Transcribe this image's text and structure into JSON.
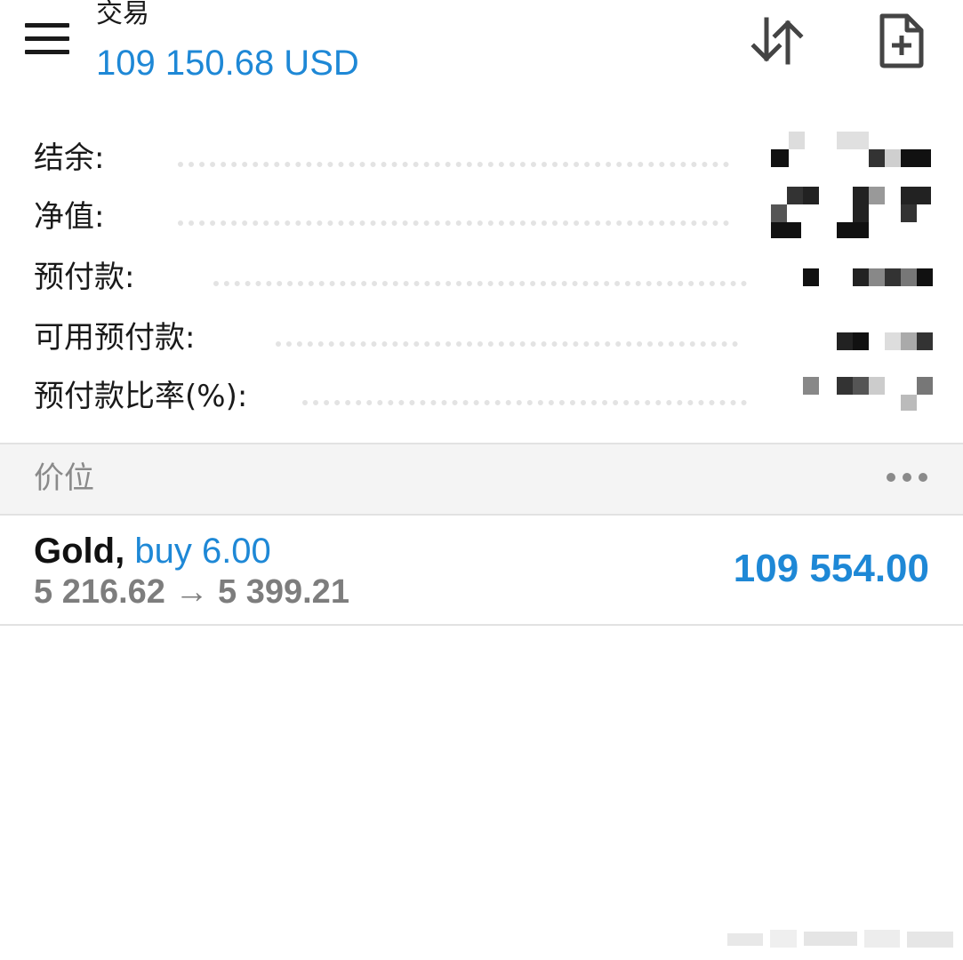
{
  "header": {
    "title": "交易",
    "balance": "109 150.68 USD",
    "menu_icon": "hamburger-menu-icon",
    "sort_icon": "sort-arrows-icon",
    "new_order_icon": "new-document-plus-icon"
  },
  "summary": {
    "rows": [
      {
        "label": "结余:"
      },
      {
        "label": "净值:"
      },
      {
        "label": "预付款:"
      },
      {
        "label": "可用预付款:"
      },
      {
        "label": "预付款比率(%):"
      }
    ]
  },
  "positions_section": {
    "title": "价位",
    "more_icon": "more-horizontal-icon"
  },
  "positions": [
    {
      "symbol": "Gold,",
      "side": "buy 6.00",
      "prices": "5 216.62 → 5 399.21",
      "profit": "109 554.00"
    }
  ],
  "colors": {
    "accent_blue": "#1e88d6",
    "text_dark": "#1a1a1a",
    "text_gray": "#7d7d7d",
    "section_bg": "#f4f4f4",
    "divider": "#e2e2e2"
  }
}
